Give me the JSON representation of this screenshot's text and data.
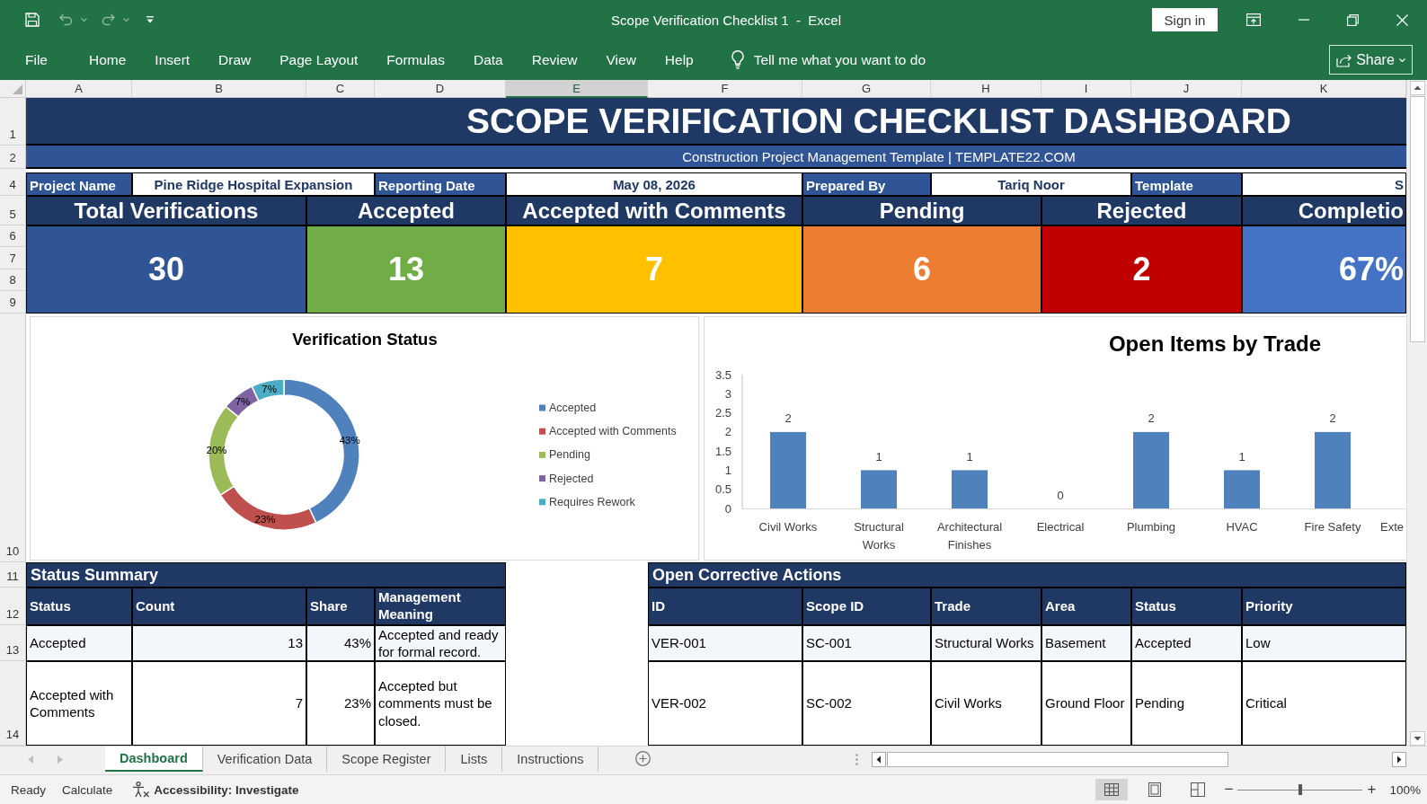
{
  "title_bar": {
    "quick_access": [
      {
        "kind": "save",
        "disabled": false
      },
      {
        "kind": "undo",
        "disabled": true
      },
      {
        "kind": "redo",
        "disabled": true
      },
      {
        "kind": "customize",
        "disabled": false
      }
    ],
    "title": "Scope Verification Checklist 1  -  Excel",
    "sign_in": "Sign in"
  },
  "ribbon": {
    "tabs": [
      "File",
      "Home",
      "Insert",
      "Draw",
      "Page Layout",
      "Formulas",
      "Data",
      "Review",
      "View",
      "Help"
    ],
    "tell_me": {
      "placeholder": "Tell me what you want to do"
    },
    "share": "Share"
  },
  "sheet": {
    "column_headers": [
      {
        "label": "A",
        "selected": false
      },
      {
        "label": "B",
        "selected": false
      },
      {
        "label": "C",
        "selected": false
      },
      {
        "label": "D",
        "selected": false
      },
      {
        "label": "E",
        "selected": true
      },
      {
        "label": "F",
        "selected": false
      },
      {
        "label": "G",
        "selected": false
      },
      {
        "label": "H",
        "selected": false
      },
      {
        "label": "I",
        "selected": false
      },
      {
        "label": "J",
        "selected": false
      },
      {
        "label": "K",
        "selected": false
      }
    ],
    "row_headers": [
      "1",
      "2",
      "4",
      "5",
      "6",
      "7",
      "8",
      "9",
      "10",
      "11",
      "12",
      "13",
      "14"
    ],
    "title": "SCOPE VERIFICATION CHECKLIST DASHBOARD",
    "subtitle": "Construction Project Management Template | TEMPLATE22.COM",
    "info": [
      {
        "label": "Project Name",
        "value": "Pine Ridge Hospital Expansion"
      },
      {
        "label": "Reporting Date",
        "value": "May 08, 2026"
      },
      {
        "label": "Prepared By",
        "value": "Tariq Noor"
      },
      {
        "label": "Template",
        "value": "S"
      }
    ],
    "kpis": [
      {
        "label": "Total Verifications",
        "value": "30",
        "color": "#2f5597"
      },
      {
        "label": "Accepted",
        "value": "13",
        "color": "#70ad47"
      },
      {
        "label": "Accepted with Comments",
        "value": "7",
        "color": "#ffc000"
      },
      {
        "label": "Pending",
        "value": "6",
        "color": "#ed7d31"
      },
      {
        "label": "Rejected",
        "value": "2",
        "color": "#c00000"
      },
      {
        "label": "Completio",
        "value": "67%",
        "color": "#4472c4"
      }
    ],
    "verification_status": {
      "chart_data": {
        "type": "donut",
        "title": "Verification Status",
        "categories": [
          "Accepted",
          "Accepted with Comments",
          "Pending",
          "Rejected",
          "Requires Rework"
        ],
        "values": [
          43,
          23,
          20,
          7,
          7
        ],
        "value_labels": [
          "43%",
          "23%",
          "20%",
          "7%",
          "7%"
        ],
        "legend": "right"
      }
    },
    "open_items_by_trade": {
      "chart_data": {
        "type": "bar",
        "title": "Open Items by Trade",
        "categories": [
          "Civil Works",
          "Structural Works",
          "Architectural Finishes",
          "Electrical",
          "Plumbing",
          "HVAC",
          "Fire Safety",
          "Exte"
        ],
        "values": [
          2,
          1,
          1,
          0,
          2,
          1,
          2,
          null
        ],
        "ylim": [
          0,
          3.5
        ],
        "yticks": [
          0,
          0.5,
          1,
          1.5,
          2,
          2.5,
          3,
          3.5
        ],
        "data_labels": true
      }
    },
    "status_summary": {
      "title": "Status Summary",
      "columns": [
        "Status",
        "Count",
        "Share",
        "Management Meaning"
      ],
      "rows": [
        [
          "Accepted",
          "13",
          "43%",
          "Accepted and ready for formal record."
        ],
        [
          "Accepted with Comments",
          "7",
          "23%",
          "Accepted but comments must be closed."
        ]
      ]
    },
    "open_corrective_actions": {
      "title": "Open Corrective Actions",
      "columns": [
        "ID",
        "Scope ID",
        "Trade",
        "Area",
        "Status",
        "Priority"
      ],
      "rows": [
        [
          "VER-001",
          "SC-001",
          "Structural Works",
          "Basement",
          "Accepted",
          "Low"
        ],
        [
          "VER-002",
          "SC-002",
          "Civil Works",
          "Ground Floor",
          "Pending",
          "Critical"
        ]
      ]
    }
  },
  "sheet_tabs": [
    {
      "label": "Dashboard",
      "selected": true
    },
    {
      "label": "Verification Data",
      "selected": false
    },
    {
      "label": "Scope Register",
      "selected": false
    },
    {
      "label": "Lists",
      "selected": false
    },
    {
      "label": "Instructions",
      "selected": false
    }
  ],
  "status_bar": {
    "mode": "Ready",
    "calculate": "Calculate",
    "accessibility": "Accessibility: Investigate",
    "views": [
      {
        "kind": "normal",
        "selected": true
      },
      {
        "kind": "page_layout",
        "selected": false
      },
      {
        "kind": "page_break",
        "selected": false
      }
    ],
    "zoom": {
      "zoom_out": "−",
      "zoom_in": "+",
      "level": 0.5,
      "reading": "100%"
    }
  }
}
